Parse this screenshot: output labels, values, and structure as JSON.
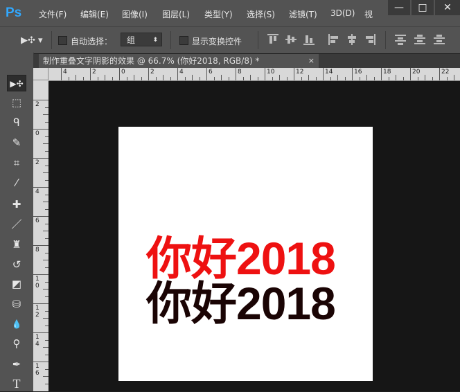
{
  "app": {
    "logo": "Ps"
  },
  "menu": [
    "文件(F)",
    "编辑(E)",
    "图像(I)",
    "图层(L)",
    "类型(Y)",
    "选择(S)",
    "滤镜(T)",
    "3D(D)",
    "视"
  ],
  "window_controls": {
    "minimize": "—",
    "maximize": "□",
    "close": "✕"
  },
  "options": {
    "move_icon": "move-tool-icon",
    "auto_select_label": "自动选择：",
    "auto_select_value": "组",
    "show_transform_label": "显示变换控件"
  },
  "tools": [
    {
      "name": "move-tool",
      "glyph": "▶✣"
    },
    {
      "name": "marquee-tool",
      "glyph": "⬚"
    },
    {
      "name": "lasso-tool",
      "glyph": "ᑫ"
    },
    {
      "name": "quick-select-tool",
      "glyph": "✎"
    },
    {
      "name": "crop-tool",
      "glyph": "⌗"
    },
    {
      "name": "eyedropper-tool",
      "glyph": "⁄"
    },
    {
      "name": "healing-brush-tool",
      "glyph": "✚"
    },
    {
      "name": "brush-tool",
      "glyph": "／"
    },
    {
      "name": "stamp-tool",
      "glyph": "♜"
    },
    {
      "name": "history-brush-tool",
      "glyph": "↺"
    },
    {
      "name": "eraser-tool",
      "glyph": "◩"
    },
    {
      "name": "paint-bucket-tool",
      "glyph": "⛁"
    },
    {
      "name": "blur-tool",
      "glyph": "💧"
    },
    {
      "name": "dodge-tool",
      "glyph": "⚲"
    },
    {
      "name": "pen-tool",
      "glyph": "✒"
    },
    {
      "name": "type-tool",
      "glyph": "T"
    }
  ],
  "document": {
    "tab_title": "制作重叠文字阴影的效果 @ 66.7% (你好2018, RGB/8) *",
    "tab_close": "×",
    "text_red": "你好2018",
    "text_dark": "你好2018"
  },
  "rulers": {
    "h_labels": [
      "4",
      "2",
      "0",
      "2",
      "4",
      "6",
      "8",
      "10",
      "12",
      "14",
      "16",
      "18",
      "20",
      "22"
    ],
    "v_labels": [
      "2",
      "0",
      "2",
      "4",
      "6",
      "8",
      "10",
      "12",
      "14",
      "16"
    ]
  },
  "colors": {
    "text_red": "#ee1111",
    "text_dark": "#1a0404",
    "ps_blue": "#31a8ff"
  }
}
